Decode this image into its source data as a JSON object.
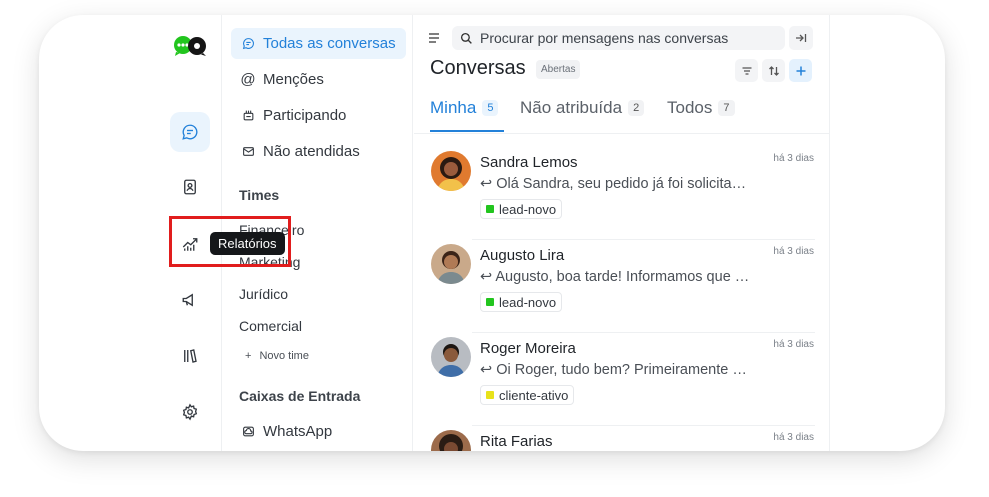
{
  "rail": {
    "items": [
      {
        "name": "conversations",
        "icon": "chat-icon"
      },
      {
        "name": "contacts",
        "icon": "contacts-icon"
      },
      {
        "name": "reports",
        "icon": "reports-icon"
      },
      {
        "name": "campaigns",
        "icon": "megaphone-icon"
      },
      {
        "name": "library",
        "icon": "library-icon"
      },
      {
        "name": "settings",
        "icon": "gear-icon"
      }
    ],
    "tooltip": "Relatórios"
  },
  "filters": {
    "all": "Todas as conversas",
    "mentions": "Menções",
    "participating": "Participando",
    "unattended": "Não atendidas",
    "teams_title": "Times",
    "teams": [
      "Financeiro",
      "Marketing",
      "Jurídico",
      "Comercial"
    ],
    "new_team": "Novo time",
    "inboxes_title": "Caixas de Entrada",
    "inboxes": [
      "WhatsApp"
    ]
  },
  "header": {
    "search_placeholder": "Procurar por mensagens nas conversas",
    "title": "Conversas",
    "status": "Abertas"
  },
  "tabs": [
    {
      "label": "Minha",
      "count": "5"
    },
    {
      "label": "Não atribuída",
      "count": "2"
    },
    {
      "label": "Todos",
      "count": "7"
    }
  ],
  "conversations": [
    {
      "name": "Sandra Lemos",
      "time": "há 3 dias",
      "message": "Olá Sandra, seu pedido já foi solicitado e está sendo preparado",
      "label": "lead-novo",
      "label_color": "#22c51e"
    },
    {
      "name": "Augusto Lira",
      "time": "há 3 dias",
      "message": "Augusto, boa tarde! Informamos que o seu atendimento foi registrado",
      "label": "lead-novo",
      "label_color": "#22c51e"
    },
    {
      "name": "Roger Moreira",
      "time": "há 3 dias",
      "message": "Oi Roger, tudo bem? Primeiramente gostaria de agradecer",
      "label": "cliente-ativo",
      "label_color": "#e8e21a"
    },
    {
      "name": "Rita Farias",
      "time": "há 3 dias",
      "message": "",
      "label": "",
      "label_color": ""
    }
  ],
  "colors": {
    "accent": "#2381d9",
    "highlight": "#e11d1d"
  }
}
